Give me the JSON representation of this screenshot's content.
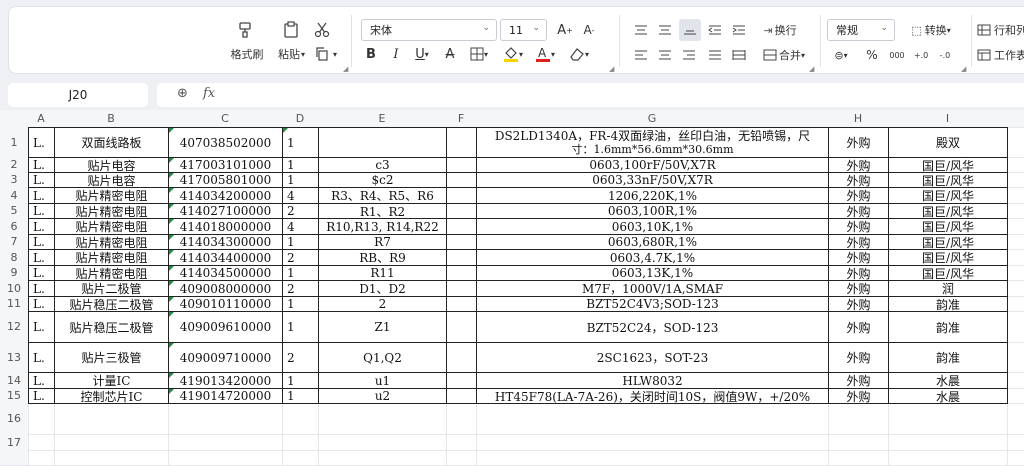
{
  "ribbon": {
    "format_painter": "格式刷",
    "paste": "粘贴",
    "font_name": "宋体",
    "font_size": "11",
    "wrap_text": "换行",
    "merge": "合并",
    "number_format": "常规",
    "convert": "转换",
    "rows_cols": "行和列",
    "worksheet": "工作表",
    "bold": "B",
    "italic": "I",
    "underline": "U",
    "strike": "A",
    "percent": "%",
    "thousands": "000",
    "dec_inc": "+.0",
    "dec_dec": "-.0",
    "font_grow": "A",
    "font_shrink": "A",
    "accent_color": "#1e8e3e",
    "font_color_bar": "#e02020",
    "fill_color_bar": "#f5d400"
  },
  "formula_bar": {
    "name_box": "J20",
    "fx": "fx",
    "formula": ""
  },
  "columns": [
    "A",
    "B",
    "C",
    "D",
    "E",
    "F",
    "G",
    "H",
    "I"
  ],
  "rows": [
    "1",
    "2",
    "3",
    "4",
    "5",
    "6",
    "7",
    "8",
    "9",
    "10",
    "11",
    "12",
    "13",
    "14",
    "15",
    "16",
    "17"
  ],
  "table": [
    {
      "a": "L.",
      "b": "双面线路板",
      "c": "407038502000",
      "d": "1",
      "e": "",
      "g1": "DS2LD1340A，FR-4双面绿油，丝印白油，无铅喷锡，尺",
      "g2": "寸：1.6mm*56.6mm*30.6mm",
      "h": "外购",
      "i": "殿双"
    },
    {
      "a": "L.",
      "b": "贴片电容",
      "c": "417003101000",
      "d": "1",
      "e": "c3",
      "g": "0603,100rF/50V,X7R",
      "h": "外购",
      "i": "国巨/风华"
    },
    {
      "a": "L.",
      "b": "贴片电容",
      "c": "417005801000",
      "d": "1",
      "e": "$c2",
      "g": "0603,33nF/50V,X7R",
      "h": "外购",
      "i": "国巨/风华"
    },
    {
      "a": "L.",
      "b": "贴片精密电阻",
      "c": "414034200000",
      "d": "4",
      "e": "R3、R4、R5、R6",
      "g": "1206,220K,1%",
      "h": "外购",
      "i": "国巨/风华"
    },
    {
      "a": "L.",
      "b": "贴片精密电阻",
      "c": "414027100000",
      "d": "2",
      "e": "R1、R2",
      "g": "0603,100R,1%",
      "h": "外购",
      "i": "国巨/风华"
    },
    {
      "a": "L.",
      "b": "贴片精密电阻",
      "c": "414018000000",
      "d": "4",
      "e": "R10,R13, R14,R22",
      "g": "0603,10K,1%",
      "h": "外购",
      "i": "国巨/风华"
    },
    {
      "a": "L.",
      "b": "贴片精密电阻",
      "c": "414034300000",
      "d": "1",
      "e": "R7",
      "g": "0603,680R,1%",
      "h": "外购",
      "i": "国巨/风华"
    },
    {
      "a": "L.",
      "b": "贴片精密电阻",
      "c": "414034400000",
      "d": "2",
      "e": "RB、R9",
      "g": "0603,4.7K,1%",
      "h": "外购",
      "i": "国巨/风华"
    },
    {
      "a": "L.",
      "b": "贴片精密电阻",
      "c": "414034500000",
      "d": "1",
      "e": "R11",
      "g": "0603,13K,1%",
      "h": "外购",
      "i": "国巨/风华"
    },
    {
      "a": "L.",
      "b": "贴片二极管",
      "c": "409008000000",
      "d": "2",
      "e": "D1、D2",
      "g": "M7F，1000V/1A,SMAF",
      "h": "外购",
      "i": "润"
    },
    {
      "a": "L.",
      "b": "贴片稳压二极管",
      "c": "409010110000",
      "d": "1",
      "e": "2",
      "g": "BZT52C4V3;SOD-123",
      "h": "外购",
      "i": "韵准"
    },
    {
      "a": "L.",
      "b": "贴片稳压二极管",
      "c": "409009610000",
      "d": "1",
      "e": "Z1",
      "g": "BZT52C24，SOD-123",
      "h": "外购",
      "i": "韵准"
    },
    {
      "a": "L.",
      "b": "贴片三极管",
      "c": "409009710000",
      "d": "2",
      "e": "Q1,Q2",
      "g": "2SC1623，SOT-23",
      "h": "外购",
      "i": "韵准"
    },
    {
      "a": "L.",
      "b": "计量IC",
      "c": "419013420000",
      "d": "1",
      "e": "u1",
      "g": "HLW8032",
      "h": "外购",
      "i": "水晨"
    },
    {
      "a": "L.",
      "b": "控制芯片IC",
      "c": "419014720000",
      "d": "1",
      "e": "u2",
      "g": "HT45F78(LA-7A-26)，关闭时间10S，阀值9W，+/20%",
      "h": "外购",
      "i": "水晨"
    }
  ]
}
